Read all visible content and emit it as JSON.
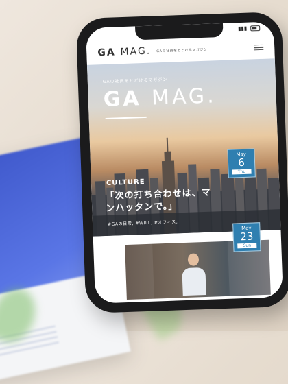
{
  "site": {
    "logo_bold": "GA",
    "logo_thin": "MAG.",
    "tagline": "GAの社員をとどけるマガジン"
  },
  "hero": {
    "kicker": "GAの社員をとどけるマガジン",
    "logo_bold": "GA",
    "logo_thin": "MAG.",
    "category": "CULTURE",
    "title": "「次の打ち合わせは、マンハッタンで。」",
    "tags": "#GAの日常, #WILL, #オフィス,",
    "date": {
      "month": "May",
      "day": "6",
      "weekday": "Thu"
    }
  },
  "article2": {
    "date": {
      "month": "May",
      "day": "23",
      "weekday": "Sun"
    }
  },
  "colors": {
    "badge": "#2f7fb0",
    "card_blue": "#3c55c8"
  },
  "icons": {
    "menu": "hamburger-menu-icon",
    "battery": "battery-icon"
  }
}
